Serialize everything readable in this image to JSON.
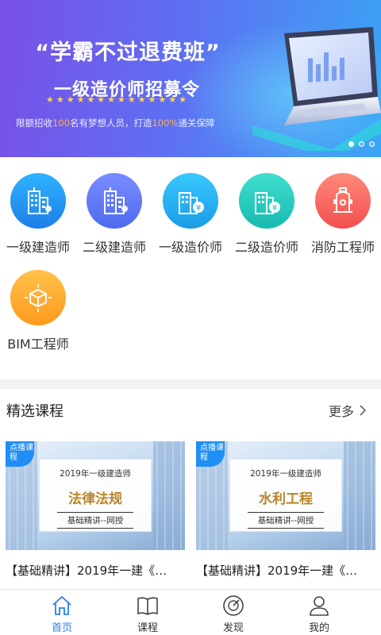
{
  "banner": {
    "title": "“学霸不过退费班”",
    "subtitle": "一级造价师招募令",
    "stars": "★★★★★★★★★★★★★★",
    "desc_parts": [
      "限额招收",
      "100",
      "名有梦想人员，打造",
      "100%",
      "通关保障"
    ],
    "slide_count": 3,
    "active_slide": 1
  },
  "categories": [
    {
      "label": "一级建造师",
      "icon": "building-icon",
      "color": "#1e7ee8"
    },
    {
      "label": "二级建造师",
      "icon": "building-icon",
      "color": "#4d6bef"
    },
    {
      "label": "一级造价师",
      "icon": "building-coin-icon",
      "color": "#1c9ce6"
    },
    {
      "label": "二级造价师",
      "icon": "building-coin-icon",
      "color": "#18b9b0"
    },
    {
      "label": "消防工程师",
      "icon": "hydrant-icon",
      "color": "#f24e4e"
    },
    {
      "label": "BIM工程师",
      "icon": "cube-icon",
      "color": "#ff9a1e"
    }
  ],
  "section": {
    "title": "精选课程",
    "more": "更多"
  },
  "courses": [
    {
      "tag": "点播课程",
      "year_line": "2019年一级建造师",
      "subject": "法律法规",
      "footer": "基础精讲--网授",
      "title": "【基础精讲】2019年一建《…"
    },
    {
      "tag": "点播课程",
      "year_line": "2019年一级建造师",
      "subject": "水利工程",
      "footer": "基础精讲--网授",
      "title": "【基础精讲】2019年一建《…"
    }
  ],
  "tabs": [
    {
      "label": "首页",
      "icon": "home-icon",
      "active": true
    },
    {
      "label": "课程",
      "icon": "book-icon",
      "active": false
    },
    {
      "label": "发现",
      "icon": "compass-icon",
      "active": false
    },
    {
      "label": "我的",
      "icon": "user-icon",
      "active": false
    }
  ],
  "colors": {
    "accent": "#2a7ff0",
    "highlight": "#ffb347",
    "subject_gold": "#b8862a"
  }
}
